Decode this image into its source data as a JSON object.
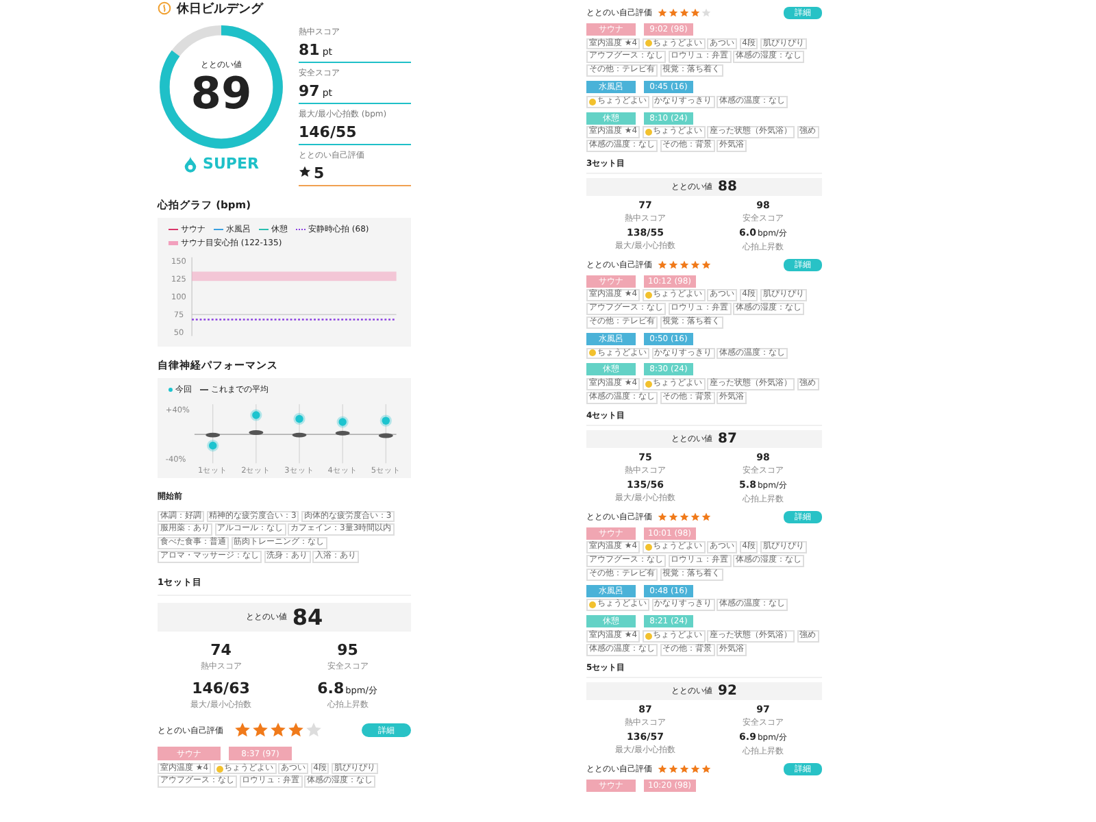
{
  "title": "休日ビルデング",
  "summary": {
    "gauge_label": "ととのい値",
    "score": "89",
    "level": 0.85,
    "grade": "SUPER",
    "stats": [
      {
        "kind": "bar",
        "label": "熱中スコア",
        "value": "81",
        "unit": "pt"
      },
      {
        "kind": "bar",
        "label": "安全スコア",
        "value": "97",
        "unit": "pt"
      },
      {
        "kind": "bar",
        "label": "最大/最小心拍数 (bpm)",
        "value": "146/55"
      },
      {
        "kind": "star",
        "label": "ととのい自己評価",
        "value": "5"
      }
    ]
  },
  "heart_chart": {
    "title": "心拍グラフ (bpm)",
    "chart_data": {
      "type": "line",
      "yticks": [
        150,
        125,
        100,
        75,
        50
      ],
      "ylim": [
        45,
        155
      ],
      "series": [
        {
          "name": "サウナ",
          "color": "#d9366a",
          "values": [
            null,
            null,
            null,
            null,
            null,
            null,
            null,
            null,
            null,
            null,
            null
          ]
        },
        {
          "name": "水風呂",
          "color": "#3aa0e0",
          "values": [
            null,
            null,
            null,
            null,
            null,
            null,
            null,
            null,
            null,
            null,
            null
          ]
        },
        {
          "name": "休憩",
          "color": "#2bbfb0",
          "values": [
            null,
            null,
            null,
            null,
            null,
            null,
            null,
            null,
            null,
            null,
            null
          ]
        },
        {
          "name": "安静時心拍 (68)",
          "color": "#8a3fe0",
          "line_style": "dotted",
          "values": [
            68,
            68,
            68,
            68,
            68,
            68,
            68,
            68,
            68,
            68,
            68
          ]
        }
      ],
      "bands": [
        {
          "axis": "y",
          "from": 122,
          "to": 135,
          "label": "サウナ目安心拍 (122-135)",
          "color": "#f2a0bd"
        }
      ]
    }
  },
  "performance": {
    "title": "自律神経パフォーマンス",
    "chart_data": {
      "type": "scatter",
      "grid": true,
      "categories": [
        "1セット",
        "2セット",
        "3セット",
        "4セット",
        "5セット"
      ],
      "ylim": [
        -40,
        40
      ],
      "yticks": [
        {
          "value": 40,
          "label": "+40%"
        },
        {
          "value": -40,
          "label": "-40%"
        }
      ],
      "series": [
        {
          "name": "今回",
          "color": "#1dc4cf",
          "values": [
            -18,
            31,
            25,
            20,
            22
          ]
        },
        {
          "name": "これまでの平均",
          "color": "#555555",
          "values": [
            -1,
            3,
            -1,
            2,
            -2
          ]
        }
      ]
    }
  },
  "before": {
    "title": "開始前",
    "chips": [
      "体調：好調",
      "精神的な疲労度合い：3",
      "肉体的な疲労度合い：3",
      "服用薬：あり",
      "アルコール：なし",
      "カフェイン：3量3時間以内",
      "食べた食事：普通",
      "筋肉トレーニング：なし",
      "アロマ・マッサージ：なし",
      "洗身：あり",
      "入浴：あり"
    ]
  },
  "sets": [
    {
      "title": "1セット目",
      "score_label": "ととのい値",
      "score": "84",
      "stats": [
        {
          "value": "74",
          "label": "熱中スコア"
        },
        {
          "value": "95",
          "label": "安全スコア"
        },
        {
          "value": "146/63",
          "label": "最大/最小心拍数"
        },
        {
          "value": "6.8",
          "unit": "bpm/分",
          "label": "心拍上昇数"
        }
      ],
      "rating_label": "ととのい自己評価",
      "stars": 4,
      "detail_button": "詳細",
      "phases": [
        {
          "kind": "sauna",
          "name": "サウナ",
          "time": "8:37 (97)",
          "chips": [
            {
              "text": "室内温度 ★4",
              "face": false
            },
            {
              "text": "ちょうどよい",
              "face": true
            },
            {
              "text": "あつい",
              "face": false
            },
            {
              "text": "4段",
              "face": false
            },
            {
              "text": "肌ぴりぴり",
              "face": false
            },
            {
              "text": "アウフグース：なし",
              "face": false
            },
            {
              "text": "ロウリュ：弁置",
              "face": false
            },
            {
              "text": "体感の湿度：なし",
              "face": false
            }
          ]
        }
      ]
    },
    {
      "rating_label": "ととのい自己評価",
      "stars": 4,
      "detail_button": "詳細",
      "phases": [
        {
          "kind": "sauna",
          "name": "サウナ",
          "time": "9:02 (98)",
          "chips": [
            {
              "text": "室内温度 ★4",
              "face": false
            },
            {
              "text": "ちょうどよい",
              "face": true
            },
            {
              "text": "あつい",
              "face": false
            },
            {
              "text": "4段",
              "face": false
            },
            {
              "text": "肌ぴりぴり",
              "face": false
            },
            {
              "text": "アウフグース：なし",
              "face": false
            },
            {
              "text": "ロウリュ：弁置",
              "face": false
            },
            {
              "text": "体感の湿度：なし",
              "face": false
            },
            {
              "text": "その他：テレビ有",
              "face": false
            },
            {
              "text": "視覚：落ち着く",
              "face": false
            }
          ]
        },
        {
          "kind": "water",
          "name": "水風呂",
          "time": "0:45 (16)",
          "chips": [
            {
              "text": "ちょうどよい",
              "face": true
            },
            {
              "text": "かなりすっきり",
              "face": false
            },
            {
              "text": "体感の温度：なし",
              "face": false
            }
          ]
        },
        {
          "kind": "rest",
          "name": "休憩",
          "time": "8:10 (24)",
          "chips": [
            {
              "text": "室内温度 ★4",
              "face": false
            },
            {
              "text": "ちょうどよい",
              "face": true
            },
            {
              "text": "座った状態（外気浴）",
              "face": false
            },
            {
              "text": "強め",
              "face": false
            },
            {
              "text": "体感の温度：なし",
              "face": false
            },
            {
              "text": "その他：背景",
              "face": false
            },
            {
              "text": "外気浴",
              "face": false
            }
          ]
        }
      ]
    },
    {
      "title": "3セット目",
      "score_label": "ととのい値",
      "score": "88",
      "stats": [
        {
          "value": "77",
          "label": "熱中スコア"
        },
        {
          "value": "98",
          "label": "安全スコア"
        },
        {
          "value": "138/55",
          "label": "最大/最小心拍数"
        },
        {
          "value": "6.0",
          "unit": "bpm/分",
          "label": "心拍上昇数"
        }
      ],
      "rating_label": "ととのい自己評価",
      "stars": 5,
      "detail_button": "詳細",
      "phases": [
        {
          "kind": "sauna",
          "name": "サウナ",
          "time": "10:12 (98)",
          "chips": [
            {
              "text": "室内温度 ★4",
              "face": false
            },
            {
              "text": "ちょうどよい",
              "face": true
            },
            {
              "text": "あつい",
              "face": false
            },
            {
              "text": "4段",
              "face": false
            },
            {
              "text": "肌ぴりぴり",
              "face": false
            },
            {
              "text": "アウフグース：なし",
              "face": false
            },
            {
              "text": "ロウリュ：弁置",
              "face": false
            },
            {
              "text": "体感の湿度：なし",
              "face": false
            },
            {
              "text": "その他：テレビ有",
              "face": false
            },
            {
              "text": "視覚：落ち着く",
              "face": false
            }
          ]
        },
        {
          "kind": "water",
          "name": "水風呂",
          "time": "0:50 (16)",
          "chips": [
            {
              "text": "ちょうどよい",
              "face": true
            },
            {
              "text": "かなりすっきり",
              "face": false
            },
            {
              "text": "体感の温度：なし",
              "face": false
            }
          ]
        },
        {
          "kind": "rest",
          "name": "休憩",
          "time": "8:30 (24)",
          "chips": [
            {
              "text": "室内温度 ★4",
              "face": false
            },
            {
              "text": "ちょうどよい",
              "face": true
            },
            {
              "text": "座った状態（外気浴）",
              "face": false
            },
            {
              "text": "強め",
              "face": false
            },
            {
              "text": "体感の温度：なし",
              "face": false
            },
            {
              "text": "その他：背景",
              "face": false
            },
            {
              "text": "外気浴",
              "face": false
            }
          ]
        }
      ]
    },
    {
      "title": "4セット目",
      "score_label": "ととのい値",
      "score": "87",
      "stats": [
        {
          "value": "75",
          "label": "熱中スコア"
        },
        {
          "value": "98",
          "label": "安全スコア"
        },
        {
          "value": "135/56",
          "label": "最大/最小心拍数"
        },
        {
          "value": "5.8",
          "unit": "bpm/分",
          "label": "心拍上昇数"
        }
      ],
      "rating_label": "ととのい自己評価",
      "stars": 5,
      "detail_button": "詳細",
      "phases": [
        {
          "kind": "sauna",
          "name": "サウナ",
          "time": "10:01 (98)",
          "chips": [
            {
              "text": "室内温度 ★4",
              "face": false
            },
            {
              "text": "ちょうどよい",
              "face": true
            },
            {
              "text": "あつい",
              "face": false
            },
            {
              "text": "4段",
              "face": false
            },
            {
              "text": "肌ぴりぴり",
              "face": false
            },
            {
              "text": "アウフグース：なし",
              "face": false
            },
            {
              "text": "ロウリュ：弁置",
              "face": false
            },
            {
              "text": "体感の湿度：なし",
              "face": false
            },
            {
              "text": "その他：テレビ有",
              "face": false
            },
            {
              "text": "視覚：落ち着く",
              "face": false
            }
          ]
        },
        {
          "kind": "water",
          "name": "水風呂",
          "time": "0:48 (16)",
          "chips": [
            {
              "text": "ちょうどよい",
              "face": true
            },
            {
              "text": "かなりすっきり",
              "face": false
            },
            {
              "text": "体感の温度：なし",
              "face": false
            }
          ]
        },
        {
          "kind": "rest",
          "name": "休憩",
          "time": "8:21 (24)",
          "chips": [
            {
              "text": "室内温度 ★4",
              "face": false
            },
            {
              "text": "ちょうどよい",
              "face": true
            },
            {
              "text": "座った状態（外気浴）",
              "face": false
            },
            {
              "text": "強め",
              "face": false
            },
            {
              "text": "体感の温度：なし",
              "face": false
            },
            {
              "text": "その他：背景",
              "face": false
            },
            {
              "text": "外気浴",
              "face": false
            }
          ]
        }
      ]
    },
    {
      "title": "5セット目",
      "score_label": "ととのい値",
      "score": "92",
      "stats": [
        {
          "value": "87",
          "label": "熱中スコア"
        },
        {
          "value": "97",
          "label": "安全スコア"
        },
        {
          "value": "136/57",
          "label": "最大/最小心拍数"
        },
        {
          "value": "6.9",
          "unit": "bpm/分",
          "label": "心拍上昇数"
        }
      ],
      "rating_label": "ととのい自己評価",
      "stars": 5,
      "detail_button": "詳細",
      "phases": [
        {
          "kind": "sauna",
          "name": "サウナ",
          "time": "10:20 (98)"
        }
      ]
    }
  ]
}
